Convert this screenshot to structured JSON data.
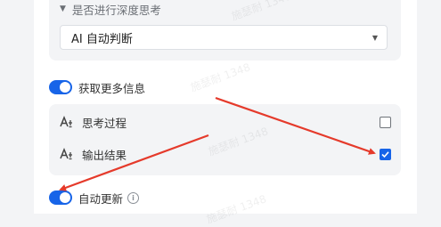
{
  "thinking": {
    "collapse_label": "是否进行深度思考",
    "select_value": "AI 自动判断"
  },
  "fetch_more": {
    "label": "获取更多信息",
    "enabled": true
  },
  "options": [
    {
      "label": "思考过程",
      "checked": false
    },
    {
      "label": "输出结果",
      "checked": true
    }
  ],
  "auto_update": {
    "label": "自动更新",
    "enabled": true
  },
  "watermark_text": "施瑟耐 1348",
  "annotation_color": "#e53a2b",
  "accent_color": "#1764e8",
  "icons": [
    "caret-down-icon",
    "chevron-down-icon",
    "font-style-icon",
    "checkmark-icon",
    "info-icon"
  ]
}
